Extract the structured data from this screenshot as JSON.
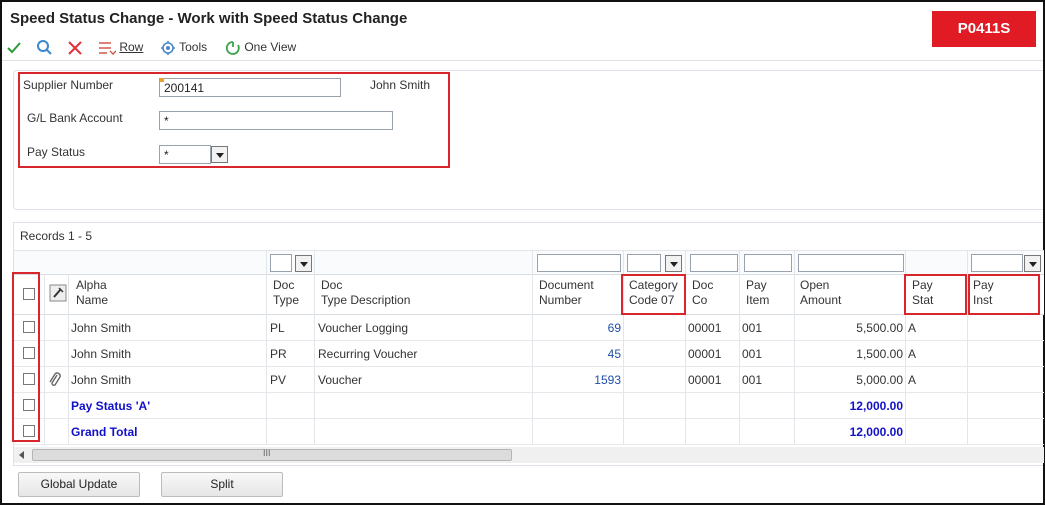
{
  "window": {
    "title": "Speed Status Change - Work with Speed Status Change",
    "form_id": "P0411S"
  },
  "toolbar": {
    "ok_icon": "checkmark-icon",
    "find_icon": "search-icon",
    "close_icon": "close-icon",
    "row_label": "Row",
    "tools_label": "Tools",
    "oneview_label": "One View"
  },
  "filters": {
    "supplier_label": "Supplier Number",
    "supplier_value": "200141",
    "supplier_name": "John Smith",
    "bank_label": "G/L Bank Account",
    "bank_value": "*",
    "paystatus_label": "Pay Status",
    "paystatus_value": "*"
  },
  "grid": {
    "records": "Records 1 - 5",
    "headers": {
      "alpha1": "Alpha",
      "alpha2": "Name",
      "doctype1": "Doc",
      "doctype2": "Type",
      "docdesc1": "Doc",
      "docdesc2": "Type Description",
      "docnum1": "Document",
      "docnum2": "Number",
      "cat1": "Category",
      "cat2": "Code 07",
      "docco1": "Doc",
      "docco2": "Co",
      "payitem1": "Pay",
      "payitem2": "Item",
      "open1": "Open",
      "open2": "Amount",
      "paystat1": "Pay",
      "paystat2": "Stat",
      "payinst1": "Pay",
      "payinst2": "Inst"
    },
    "rows": [
      {
        "name": "John Smith",
        "doc_type": "PL",
        "desc": "Voucher Logging",
        "doc_num": "69",
        "doc_co": "00001",
        "pay_item": "001",
        "amount": "5,500.00",
        "pay_stat": "A"
      },
      {
        "name": "John Smith",
        "doc_type": "PR",
        "desc": "Recurring Voucher",
        "doc_num": "45",
        "doc_co": "00001",
        "pay_item": "001",
        "amount": "1,500.00",
        "pay_stat": "A"
      },
      {
        "name": "John Smith",
        "doc_type": "PV",
        "desc": "Voucher",
        "doc_num": "1593",
        "doc_co": "00001",
        "pay_item": "001",
        "amount": "5,000.00",
        "pay_stat": "A"
      }
    ],
    "subtotal": {
      "label": "Pay Status 'A'",
      "amount": "12,000.00"
    },
    "total": {
      "label": "Grand Total",
      "amount": "12,000.00"
    },
    "scroll_grip": "III"
  },
  "buttons": {
    "global_update": "Global Update",
    "split": "Split"
  },
  "colors": {
    "highlight": "#d9262c",
    "badge": "#e01b24",
    "total_text": "#1010c8",
    "link_number": "#1f4fa8"
  }
}
